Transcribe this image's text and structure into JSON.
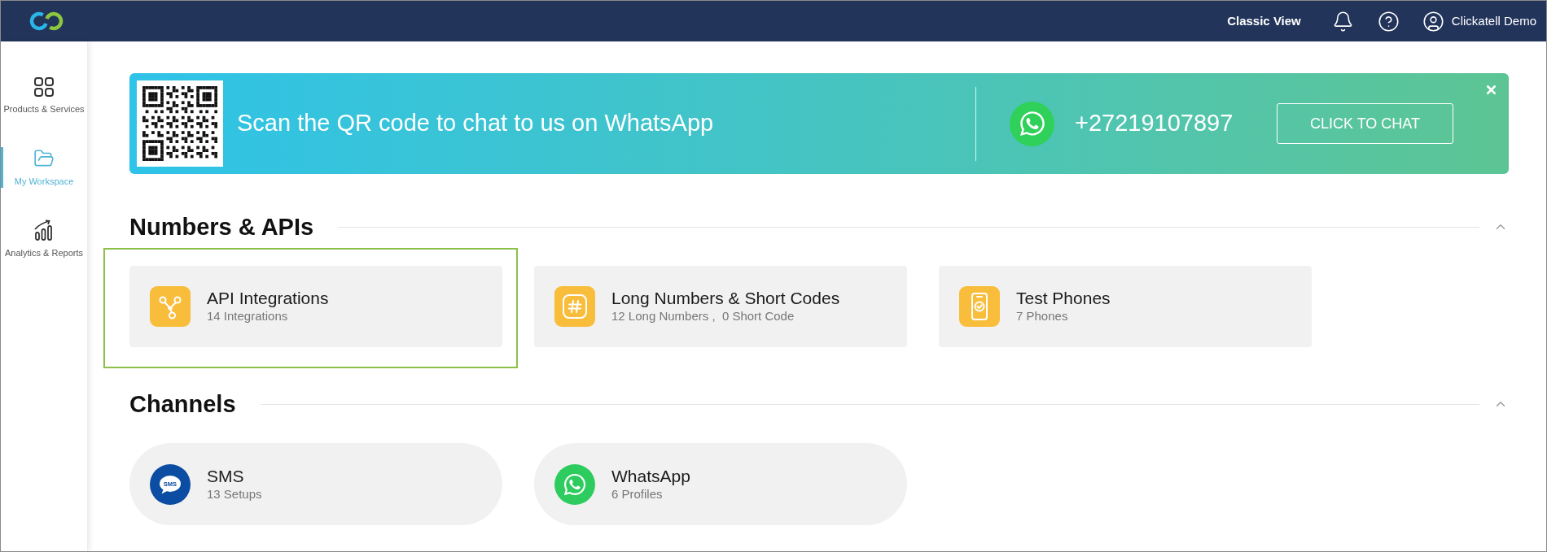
{
  "top_bar": {
    "link": "Classic View",
    "user_name": "Clickatell Demo"
  },
  "sidebar": {
    "items": [
      {
        "kind": "products",
        "label": "Products & Services",
        "selected": false
      },
      {
        "kind": "workspace",
        "label": "My Workspace",
        "selected": true
      },
      {
        "kind": "analytics",
        "label": "Analytics & Reports",
        "selected": false
      }
    ]
  },
  "banner": {
    "message": "Scan the QR code to chat to us on WhatsApp",
    "phone": "+27219107897",
    "button": "CLICK TO CHAT"
  },
  "sections": [
    {
      "title": "Numbers & APIs",
      "kind": "tiles",
      "expanded": true,
      "cards": [
        {
          "kind": "integrations",
          "title": "API Integrations",
          "subtitle": "14 Integrations",
          "highlighted": true
        },
        {
          "kind": "numbers",
          "title": "Long Numbers & Short Codes",
          "subtitle": "12 Long Numbers ,  0 Short Code",
          "highlighted": false
        },
        {
          "kind": "phones",
          "title": "Test Phones",
          "subtitle": "7 Phones",
          "highlighted": false
        }
      ]
    },
    {
      "title": "Channels",
      "kind": "pills",
      "expanded": true,
      "cards": [
        {
          "kind": "sms",
          "title": "SMS",
          "subtitle": "13 Setups",
          "icon_label": "SMS",
          "highlighted": false
        },
        {
          "kind": "whatsapp",
          "title": "WhatsApp",
          "subtitle": "6 Profiles",
          "highlighted": false
        }
      ]
    }
  ]
}
